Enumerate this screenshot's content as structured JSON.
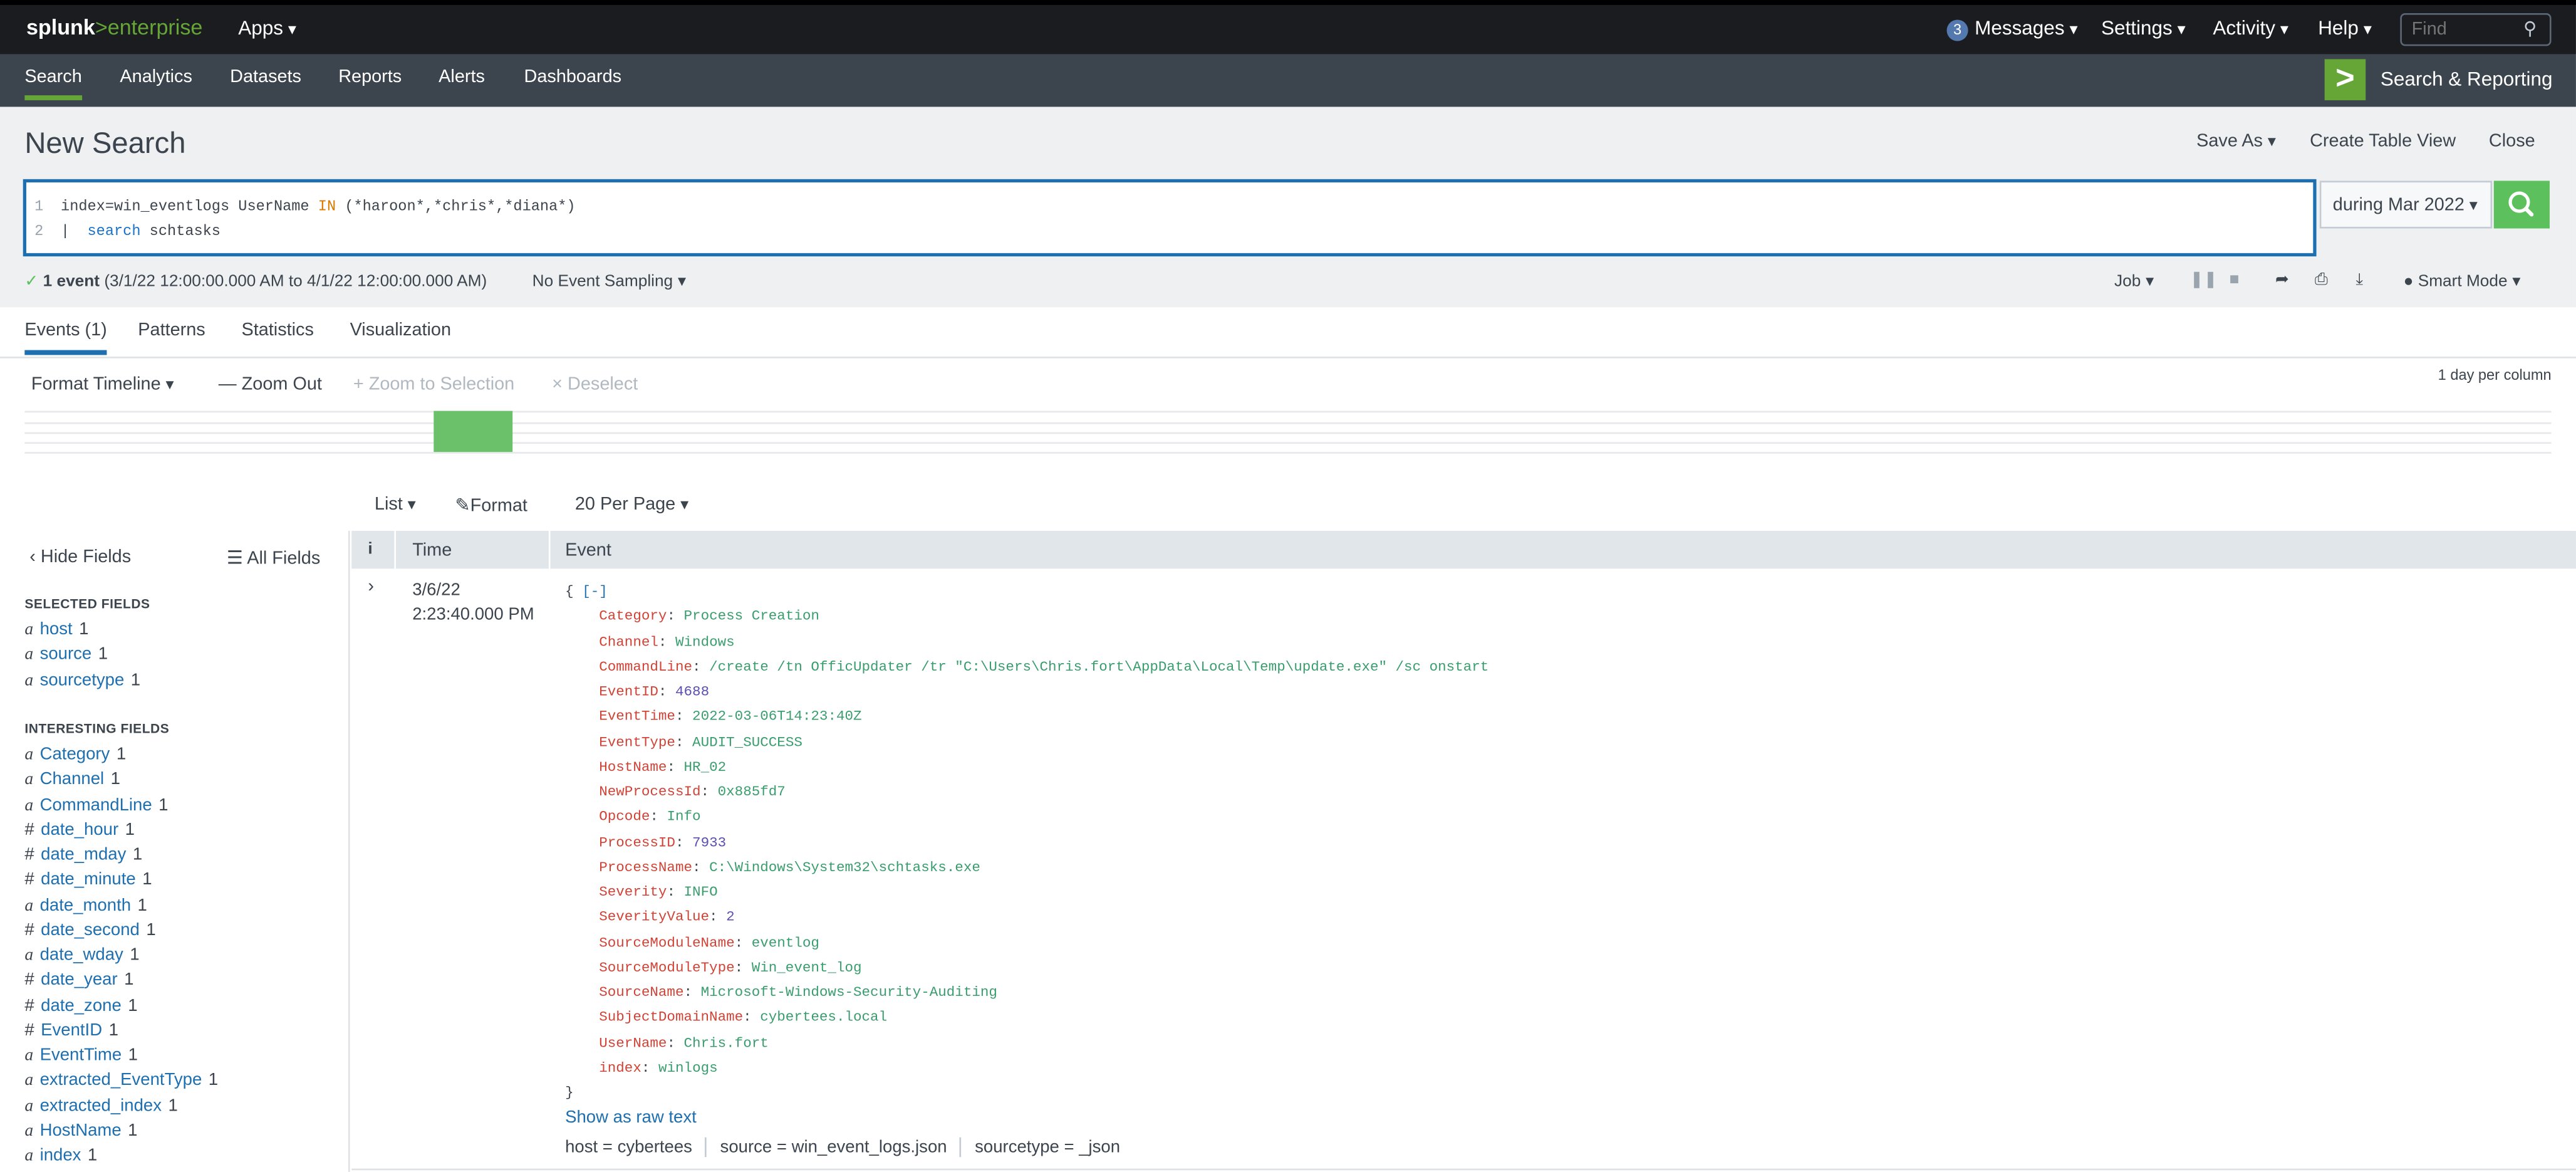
{
  "topbar": {
    "brand_main": "splunk",
    "brand_gt": ">",
    "brand_sub": "enterprise",
    "apps": "Apps",
    "messages_count": "3",
    "messages": "Messages",
    "settings": "Settings",
    "activity": "Activity",
    "help": "Help",
    "find_placeholder": "Find"
  },
  "appbar": {
    "nav": [
      "Search",
      "Analytics",
      "Datasets",
      "Reports",
      "Alerts",
      "Dashboards"
    ],
    "app_title": "Search & Reporting"
  },
  "header": {
    "title": "New Search",
    "save_as": "Save As",
    "create_table_view": "Create Table View",
    "close": "Close"
  },
  "query": {
    "line1_num": "1",
    "line2_num": "2",
    "line1_a": "index=win_eventlogs UserName ",
    "line1_kw": "IN",
    "line1_b": " (*haroon*,*chris*,*diana*)",
    "line2_pipe": "|  ",
    "line2_cmd": "search",
    "line2_rest": " schtasks"
  },
  "timepicker": "during Mar 2022",
  "status": {
    "count": "1 event",
    "range": "(3/1/22 12:00:00.000 AM to 4/1/22 12:00:00.000 AM)",
    "sampling": "No Event Sampling",
    "job": "Job",
    "mode": "Smart Mode"
  },
  "tabs": [
    "Events (1)",
    "Patterns",
    "Statistics",
    "Visualization"
  ],
  "timeline": {
    "format": "Format Timeline",
    "zoom_out": "Zoom Out",
    "zoom_to_selection": "Zoom to Selection",
    "deselect": "Deselect",
    "scale": "1 day per column"
  },
  "results_toolbar": {
    "list": "List",
    "format": "Format",
    "per_page": "20 Per Page"
  },
  "sidebar": {
    "hide_fields": "Hide Fields",
    "all_fields": "All Fields",
    "selected_heading": "SELECTED FIELDS",
    "selected": [
      {
        "type": "a",
        "name": "host",
        "count": "1"
      },
      {
        "type": "a",
        "name": "source",
        "count": "1"
      },
      {
        "type": "a",
        "name": "sourcetype",
        "count": "1"
      }
    ],
    "interesting_heading": "INTERESTING FIELDS",
    "interesting": [
      {
        "type": "a",
        "name": "Category",
        "count": "1"
      },
      {
        "type": "a",
        "name": "Channel",
        "count": "1"
      },
      {
        "type": "a",
        "name": "CommandLine",
        "count": "1"
      },
      {
        "type": "#",
        "name": "date_hour",
        "count": "1"
      },
      {
        "type": "#",
        "name": "date_mday",
        "count": "1"
      },
      {
        "type": "#",
        "name": "date_minute",
        "count": "1"
      },
      {
        "type": "a",
        "name": "date_month",
        "count": "1"
      },
      {
        "type": "#",
        "name": "date_second",
        "count": "1"
      },
      {
        "type": "a",
        "name": "date_wday",
        "count": "1"
      },
      {
        "type": "#",
        "name": "date_year",
        "count": "1"
      },
      {
        "type": "#",
        "name": "date_zone",
        "count": "1"
      },
      {
        "type": "#",
        "name": "EventID",
        "count": "1"
      },
      {
        "type": "a",
        "name": "EventTime",
        "count": "1"
      },
      {
        "type": "a",
        "name": "extracted_EventType",
        "count": "1"
      },
      {
        "type": "a",
        "name": "extracted_index",
        "count": "1"
      },
      {
        "type": "a",
        "name": "HostName",
        "count": "1"
      },
      {
        "type": "a",
        "name": "index",
        "count": "1"
      }
    ]
  },
  "table": {
    "col_info": "i",
    "col_time": "Time",
    "col_event": "Event"
  },
  "event": {
    "date": "3/6/22",
    "time": "2:23:40.000 PM",
    "open": "{ ",
    "collapse": "[-]",
    "close": "}",
    "fields": [
      {
        "key": "Category",
        "value": "Process Creation",
        "kind": "v"
      },
      {
        "key": "Channel",
        "value": "Windows",
        "kind": "v"
      },
      {
        "key": "CommandLine",
        "value": "/create /tn OfficUpdater /tr \"C:\\Users\\Chris.fort\\AppData\\Local\\Temp\\update.exe\" /sc onstart",
        "kind": "v"
      },
      {
        "key": "EventID",
        "value": "4688",
        "kind": "n"
      },
      {
        "key": "EventTime",
        "value": "2022-03-06T14:23:40Z",
        "kind": "v"
      },
      {
        "key": "EventType",
        "value": "AUDIT_SUCCESS",
        "kind": "v"
      },
      {
        "key": "HostName",
        "value": "HR_02",
        "kind": "v"
      },
      {
        "key": "NewProcessId",
        "value": "0x885fd7",
        "kind": "v"
      },
      {
        "key": "Opcode",
        "value": "Info",
        "kind": "v"
      },
      {
        "key": "ProcessID",
        "value": "7933",
        "kind": "n"
      },
      {
        "key": "ProcessName",
        "value": "C:\\Windows\\System32\\schtasks.exe",
        "kind": "v"
      },
      {
        "key": "Severity",
        "value": "INFO",
        "kind": "v"
      },
      {
        "key": "SeverityValue",
        "value": "2",
        "kind": "n"
      },
      {
        "key": "SourceModuleName",
        "value": "eventlog",
        "kind": "v"
      },
      {
        "key": "SourceModuleType",
        "value": "Win_event_log",
        "kind": "v"
      },
      {
        "key": "SourceName",
        "value": "Microsoft-Windows-Security-Auditing",
        "kind": "v"
      },
      {
        "key": "SubjectDomainName",
        "value": "cybertees.local",
        "kind": "v"
      },
      {
        "key": "UserName",
        "value": "Chris.fort",
        "kind": "v"
      },
      {
        "key": "index",
        "value": "winlogs",
        "kind": "v"
      }
    ],
    "show_raw": "Show as raw text",
    "meta": [
      {
        "label": "host = ",
        "value": "cybertees"
      },
      {
        "label": "source = ",
        "value": "win_event_logs.json"
      },
      {
        "label": "sourcetype = ",
        "value": "_json"
      }
    ]
  },
  "colors": {
    "accent_green": "#65a637",
    "link_blue": "#1e6fb0",
    "topbar": "#1a1c20",
    "appbar": "#3c444d"
  }
}
